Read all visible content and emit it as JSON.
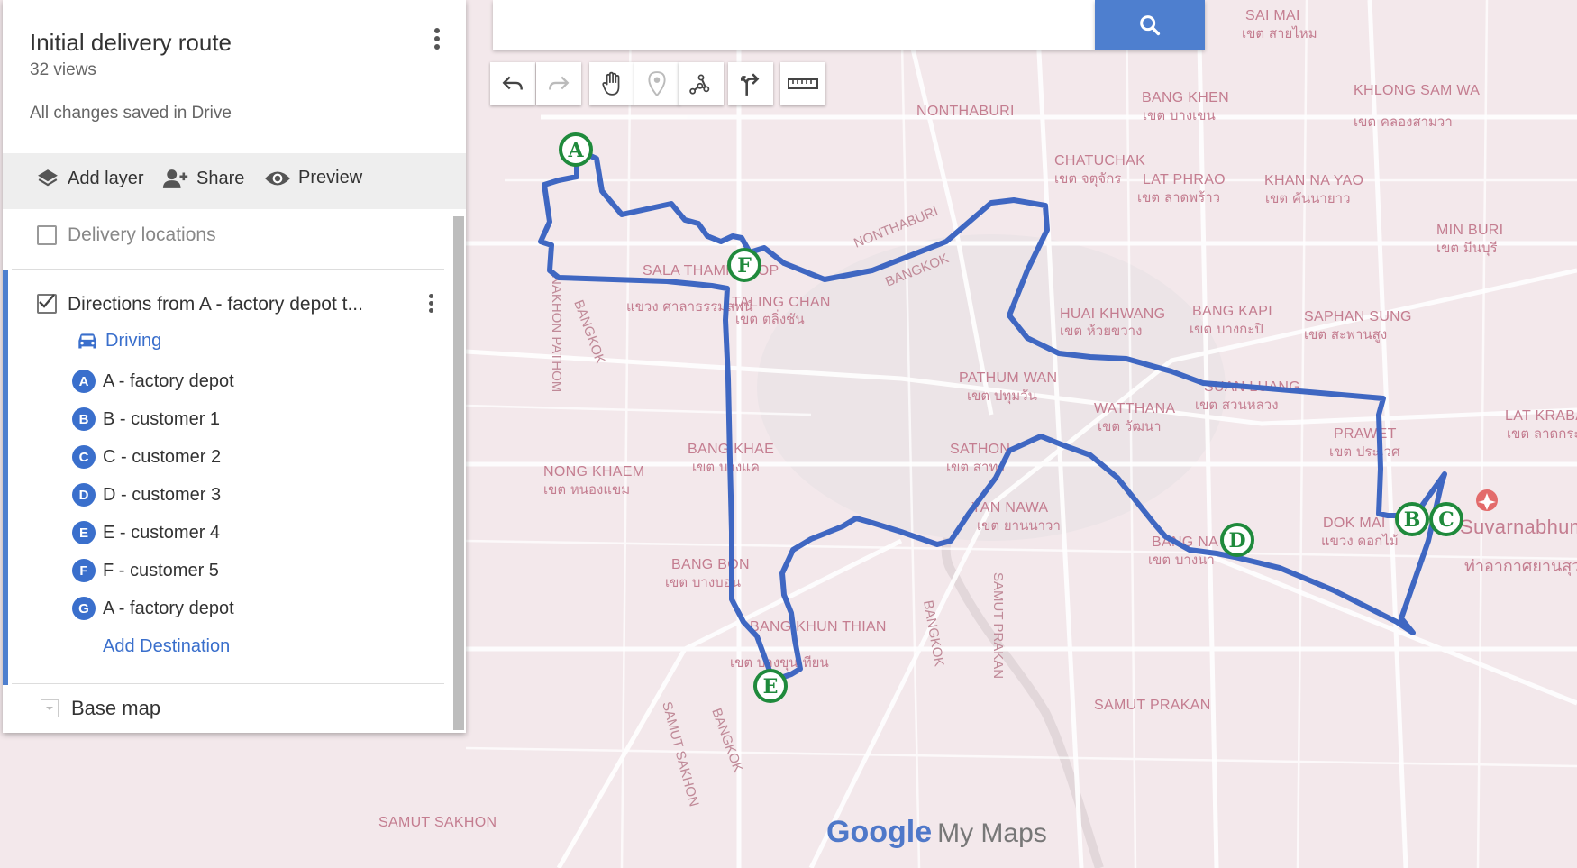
{
  "panel": {
    "title": "Initial delivery route",
    "views": "32 views",
    "saved_status": "All changes saved in Drive",
    "actions": {
      "add_layer": "Add layer",
      "share": "Share",
      "preview": "Preview"
    },
    "layers": [
      {
        "label": "Delivery locations",
        "checked": false
      },
      {
        "label": "Directions from A - factory depot t...",
        "checked": true
      }
    ],
    "travel_mode": "Driving",
    "stops": [
      {
        "badge": "A",
        "label": "A - factory depot"
      },
      {
        "badge": "B",
        "label": "B - customer 1"
      },
      {
        "badge": "C",
        "label": "C - customer 2"
      },
      {
        "badge": "D",
        "label": "D - customer 3"
      },
      {
        "badge": "E",
        "label": "E - customer 4"
      },
      {
        "badge": "F",
        "label": "F - customer 5"
      },
      {
        "badge": "G",
        "label": "A - factory depot"
      }
    ],
    "add_destination": "Add Destination",
    "base_map": "Base map"
  },
  "search": {
    "placeholder": ""
  },
  "toolbar": [
    "undo-icon",
    "redo-icon",
    "hand-icon",
    "marker-icon",
    "draw-line-icon",
    "directions-icon",
    "ruler-icon"
  ],
  "map": {
    "route_color": "#3f67c2",
    "marker_color": "#1f8a3c",
    "markers": [
      "A",
      "B",
      "C",
      "D",
      "E",
      "F"
    ],
    "place_labels": [
      {
        "en": "SAI MAI",
        "th": "เขต สายไหม"
      },
      {
        "en": "BANG KHEN",
        "th": "เขต บางเขน"
      },
      {
        "en": "KHLONG SAM WA",
        "th": "เขต คลองสามวา"
      },
      {
        "en": "NONTHABURI",
        "th": ""
      },
      {
        "en": "CHATUCHAK",
        "th": "เขต จตุจักร"
      },
      {
        "en": "LAT PHRAO",
        "th": "เขต ลาดพร้าว"
      },
      {
        "en": "KHAN NA YAO",
        "th": "เขต คันนายาว"
      },
      {
        "en": "MIN BURI",
        "th": "เขต มีนบุรี"
      },
      {
        "en": "SALA THAMMASOP",
        "th": "แขวง ศาลาธรรมสพน์"
      },
      {
        "en": "TALING CHAN",
        "th": "เขต ตลิ่งชัน"
      },
      {
        "en": "HUAI KHWANG",
        "th": "เขต ห้วยขวาง"
      },
      {
        "en": "BANG KAPI",
        "th": "เขต บางกะปิ"
      },
      {
        "en": "SAPHAN SUNG",
        "th": "เขต สะพานสูง"
      },
      {
        "en": "PATHUM WAN",
        "th": "เขต ปทุมวัน"
      },
      {
        "en": "WATTHANA",
        "th": "เขต วัฒนา"
      },
      {
        "en": "SUAN LUANG",
        "th": "เขต สวนหลวง"
      },
      {
        "en": "PRAWET",
        "th": "เขต ประเวศ"
      },
      {
        "en": "LAT KRABANG",
        "th": "เขต ลาดกระบัง"
      },
      {
        "en": "BANG KHAE",
        "th": "เขต บางแค"
      },
      {
        "en": "NONG KHAEM",
        "th": "เขต หนองแขม"
      },
      {
        "en": "SATHON",
        "th": "เขต สาทร"
      },
      {
        "en": "YAN NAWA",
        "th": "เขต ยานนาวา"
      },
      {
        "en": "DOK MAI",
        "th": "แขวง ดอกไม้"
      },
      {
        "en": "BANG NA",
        "th": "เขต บางนา"
      },
      {
        "en": "BANG BON",
        "th": "เขต บางบอน"
      },
      {
        "en": "BANG KHUN THIAN",
        "th": "เขต บางขุนเทียน"
      },
      {
        "en": "SAMUT PRAKAN",
        "th": ""
      },
      {
        "en": "SAMUT SAKHON",
        "th": ""
      }
    ],
    "airport": {
      "en": "Suvarnabhumi Airport",
      "th": "ท่าอากาศยานสุวรรณภูมิ"
    },
    "road_labels": [
      "NONTHABURI",
      "BANGKOK",
      "NAKHON PATHOM",
      "BANGKOK",
      "SAMUT PRAKAN",
      "BANGKOK",
      "SAMUT SAKHON",
      "BANGKOK"
    ]
  },
  "branding": {
    "google": "Google",
    "product": "My Maps"
  }
}
